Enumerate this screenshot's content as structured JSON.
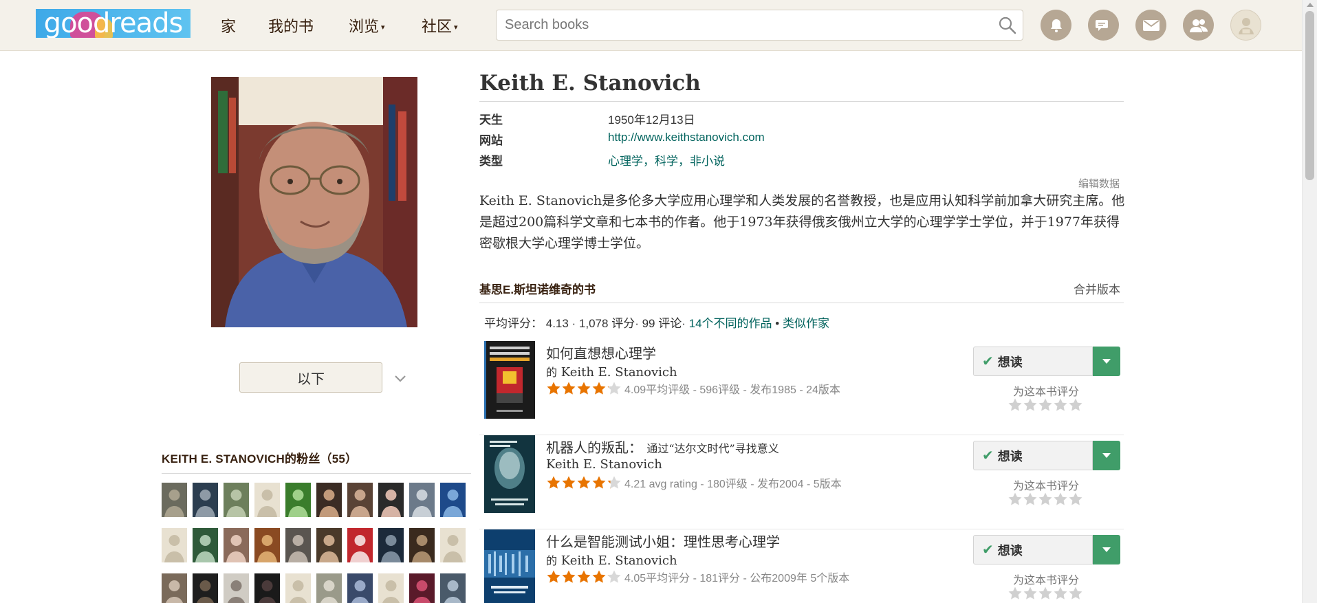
{
  "header": {
    "logo_text": "goodreads",
    "nav": [
      {
        "label": "家",
        "has_caret": false
      },
      {
        "label": "我的书",
        "has_caret": false
      },
      {
        "label": "浏览",
        "has_caret": true
      },
      {
        "label": "社区",
        "has_caret": true
      }
    ],
    "search_placeholder": "Search books",
    "icons": [
      "bell-icon",
      "discussion-icon",
      "mail-icon",
      "friends-icon",
      "profile-avatar"
    ]
  },
  "author": {
    "name": "Keith E. Stanovich",
    "born_label": "天生",
    "born_value": "1950年12月13日",
    "website_label": "网站",
    "website_value": "http://www.keithstanovich.com",
    "genre_label": "类型",
    "genres": "心理学，科学，非小说",
    "edit_data": "编辑数据",
    "bio": "Keith E. Stanovich是多伦多大学应用心理学和人类发展的名誉教授，也是应用认知科学前加拿大研究主席。他是超过200篇科学文章和七本书的作者。他于1973年获得俄亥俄州立大学的心理学学士学位，并于1977年获得密歇根大学心理学博士学位。",
    "follow_label": "以下"
  },
  "fans": {
    "title": "KEITH E. STANOVICH的粉丝（55）"
  },
  "books": {
    "section_title": "基思E.斯坦诺维奇的书",
    "merge_label": "合并版本",
    "avg_prefix": "平均评分：",
    "avg_value": "4.13 · 1,078 评分· 99 评论·",
    "works_link": "14个不同的作品",
    "bullet": "•",
    "similar_link": "类似作家",
    "want_label": "想读",
    "rate_label": "为这本书评分",
    "items": [
      {
        "title": "如何直想想心理学",
        "subtitle": "",
        "author_prefix": "的",
        "author": "Keith E. Stanovich",
        "rating_text": "4.09平均评级 - 596评级 - 发布1985 - 24版本",
        "avg": 4.09
      },
      {
        "title": "机器人的叛乱：",
        "subtitle": "通过“达尔文时代”寻找意义",
        "author_prefix": "",
        "author": "Keith E. Stanovich",
        "rating_text": "4.21 avg rating - 180评级 - 发布2004 - 5版本",
        "avg": 4.21
      },
      {
        "title": "什么是智能测试小姐：理性思考心理学",
        "subtitle": "",
        "author_prefix": "的",
        "author": "Keith E. Stanovich",
        "rating_text": "4.05平均评分 - 181评分 - 公布2009年 5个版本",
        "avg": 4.05
      }
    ]
  },
  "colors": {
    "header_bg": "#f4f1ea",
    "link": "#00635d",
    "star": "#e87400",
    "want_green": "#409d69"
  }
}
